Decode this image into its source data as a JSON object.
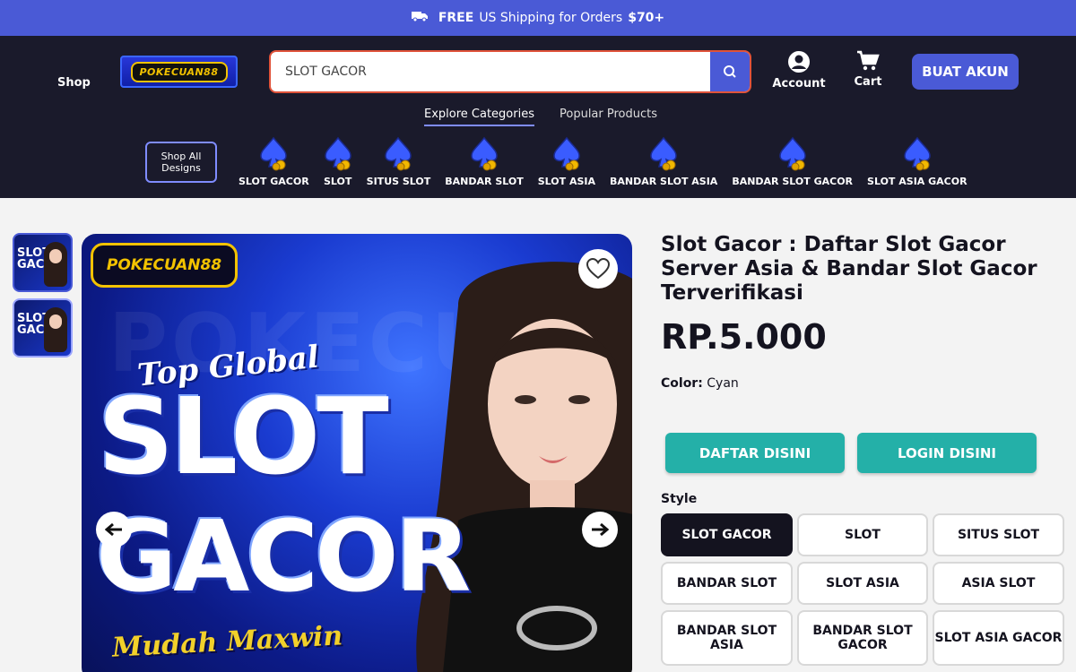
{
  "promo": {
    "prefix": "FREE",
    "middle": "US Shipping for Orders",
    "amount": "$70+"
  },
  "header": {
    "shop_label": "Shop",
    "logo_text": "POKECUAN88",
    "search_value": "SLOT GACOR",
    "account_label": "Account",
    "cart_label": "Cart",
    "cta_label": "BUAT AKUN"
  },
  "tabs": [
    {
      "label": "Explore Categories"
    },
    {
      "label": "Popular Products"
    }
  ],
  "shop_all": "Shop All Designs",
  "categories": [
    {
      "label": "SLOT GACOR"
    },
    {
      "label": "SLOT"
    },
    {
      "label": "SITUS SLOT"
    },
    {
      "label": "BANDAR SLOT"
    },
    {
      "label": "SLOT ASIA"
    },
    {
      "label": "BANDAR SLOT ASIA"
    },
    {
      "label": "BANDAR SLOT GACOR"
    },
    {
      "label": "SLOT ASIA GACOR"
    }
  ],
  "hero": {
    "logo_text": "POKECUAN88",
    "top": "Top Global",
    "big1": "SLOT",
    "big2": "GACOR",
    "sub": "Mudah Maxwin"
  },
  "thumbs": [
    {
      "line1": "SLOT",
      "line2": "GACOR"
    },
    {
      "line1": "SLOT",
      "line2": "GACOR"
    }
  ],
  "product": {
    "title": "Slot Gacor : Daftar Slot Gacor Server Asia & Bandar Slot Gacor Terverifikasi",
    "price": "RP.5.000",
    "color_label": "Color:",
    "color_value": "Cyan",
    "daftar": "DAFTAR DISINI",
    "login": "LOGIN DISINI",
    "style_label": "Style",
    "styles": [
      "SLOT GACOR",
      "SLOT",
      "SITUS SLOT",
      "BANDAR SLOT",
      "SLOT ASIA",
      "ASIA SLOT",
      "BANDAR SLOT ASIA",
      "BANDAR SLOT GACOR",
      "SLOT ASIA GACOR"
    ]
  },
  "colors": {
    "accent": "#4a5ad6",
    "header_bg": "#1a1a2b",
    "teal": "#24b0a8",
    "dark": "#14131f"
  }
}
